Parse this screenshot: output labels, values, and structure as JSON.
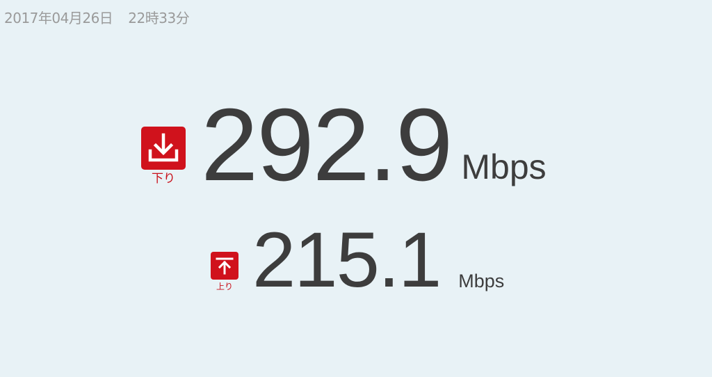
{
  "timestamp": {
    "date": "2017年04月26日",
    "time": "22時33分"
  },
  "download": {
    "label": "下り",
    "value": "292.9",
    "unit": "Mbps",
    "icon": "download-icon",
    "color": "#d0121c"
  },
  "upload": {
    "label": "上り",
    "value": "215.1",
    "unit": "Mbps",
    "icon": "upload-icon",
    "color": "#d0121c"
  }
}
